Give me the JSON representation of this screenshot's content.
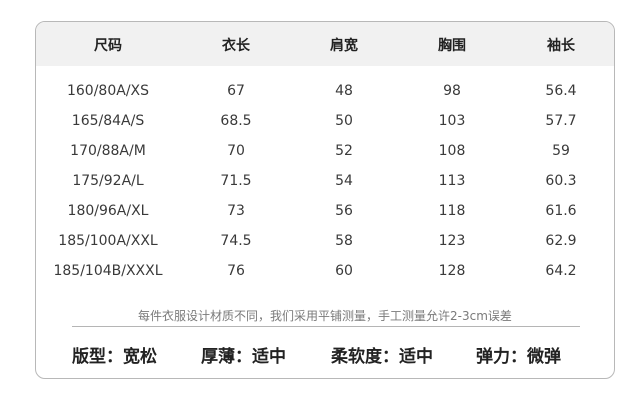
{
  "header": [
    "尺码",
    "衣长",
    "肩宽",
    "胸围",
    "袖长"
  ],
  "rows": [
    [
      "160/80A/XS",
      "67",
      "48",
      "98",
      "56.4"
    ],
    [
      "165/84A/S",
      "68.5",
      "50",
      "103",
      "57.7"
    ],
    [
      "170/88A/M",
      "70",
      "52",
      "108",
      "59"
    ],
    [
      "175/92A/L",
      "71.5",
      "54",
      "113",
      "60.3"
    ],
    [
      "180/96A/XL",
      "73",
      "56",
      "118",
      "61.6"
    ],
    [
      "185/100A/XXL",
      "74.5",
      "58",
      "123",
      "62.9"
    ],
    [
      "185/104B/XXXL",
      "76",
      "60",
      "128",
      "64.2"
    ]
  ],
  "note": "每件衣服设计材质不同，我们采用平铺测量，手工测量允许2-3cm误差",
  "specs": [
    "版型：宽松",
    "厚薄：适中",
    "柔软度：适中",
    "弹力：微弹"
  ]
}
